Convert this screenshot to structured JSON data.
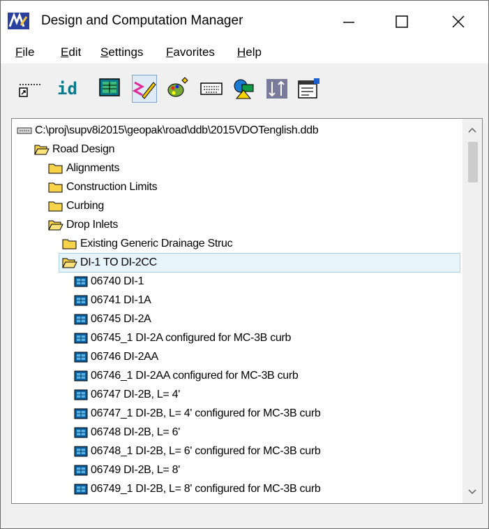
{
  "window": {
    "title": "Design and Computation Manager",
    "controls": [
      "minimize-icon",
      "maximize-icon",
      "close-icon"
    ]
  },
  "menu": [
    {
      "label": "File"
    },
    {
      "label": "Edit"
    },
    {
      "label": "Settings"
    },
    {
      "label": "Favorites"
    },
    {
      "label": "Help"
    }
  ],
  "toolbar": {
    "buttons": [
      {
        "icon": "measure-icon"
      },
      {
        "icon": "id-icon",
        "text": "id"
      },
      {
        "icon": "display-icon"
      },
      {
        "icon": "draw-icon",
        "pressed": true
      },
      {
        "icon": "palette-icon"
      },
      {
        "icon": "keyin-icon"
      },
      {
        "icon": "shapes-icon"
      },
      {
        "icon": "sort-icon"
      },
      {
        "icon": "properties-icon"
      }
    ]
  },
  "tree": {
    "nodes": [
      {
        "text": "C:\\proj\\supv8i2015\\geopak\\road\\ddb\\2015VDOTenglish.ddb",
        "icon": "drive-icon",
        "level": 0
      },
      {
        "text": "Road Design",
        "icon": "folder-open-icon",
        "level": 1
      },
      {
        "text": "Alignments",
        "icon": "folder-icon",
        "level": 2
      },
      {
        "text": "Construction Limits",
        "icon": "folder-icon",
        "level": 2
      },
      {
        "text": "Curbing",
        "icon": "folder-icon",
        "level": 2
      },
      {
        "text": "Drop Inlets",
        "icon": "folder-open-icon",
        "level": 2
      },
      {
        "text": "Existing Generic Drainage Struc",
        "icon": "folder-icon",
        "level": 3
      },
      {
        "text": "DI-1 TO DI-2CC",
        "icon": "folder-open-icon",
        "level": 3,
        "selected": true
      },
      {
        "text": "06740 DI-1",
        "icon": "item-icon",
        "level": 4
      },
      {
        "text": "06741 DI-1A",
        "icon": "item-icon",
        "level": 4
      },
      {
        "text": "06745 DI-2A",
        "icon": "item-icon",
        "level": 4
      },
      {
        "text": "06745_1 DI-2A configured for MC-3B curb",
        "icon": "item-icon",
        "level": 4
      },
      {
        "text": "06746 DI-2AA",
        "icon": "item-icon",
        "level": 4
      },
      {
        "text": "06746_1 DI-2AA configured for MC-3B curb",
        "icon": "item-icon",
        "level": 4
      },
      {
        "text": "06747 DI-2B, L= 4'",
        "icon": "item-icon",
        "level": 4
      },
      {
        "text": "06747_1 DI-2B, L= 4' configured for MC-3B curb",
        "icon": "item-icon",
        "level": 4
      },
      {
        "text": "06748 DI-2B, L= 6'",
        "icon": "item-icon",
        "level": 4
      },
      {
        "text": "06748_1 DI-2B, L= 6'  configured for MC-3B curb",
        "icon": "item-icon",
        "level": 4
      },
      {
        "text": "06749 DI-2B, L= 8'",
        "icon": "item-icon",
        "level": 4
      },
      {
        "text": "06749_1 DI-2B, L= 8' configured for MC-3B curb",
        "icon": "item-icon",
        "level": 4
      }
    ]
  },
  "scrollbar": {
    "position": 0.0
  }
}
